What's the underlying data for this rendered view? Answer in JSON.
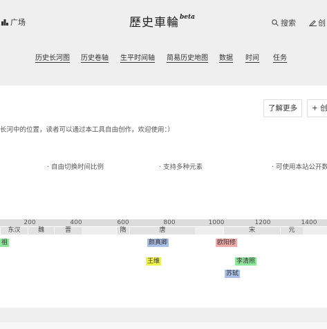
{
  "header": {
    "square_label": "广场",
    "logo_text": "歷史車輪",
    "logo_badge": "beta",
    "search_label": "搜索",
    "create_label": "创"
  },
  "nav": {
    "items": [
      "历史长河图",
      "历史卷轴",
      "生平时间轴",
      "简易历史地图",
      "数据",
      "时间",
      "任务"
    ]
  },
  "card": {
    "learn_more": "了解更多",
    "create_button": "+ 创",
    "intro_text": "长河中的位置，读者可以通过本工具自由创作，欢迎使用：）",
    "features": [
      "· 自由切换时间比例",
      "· 支持多种元素",
      "· 可使用本站公开数"
    ]
  },
  "timeline": {
    "ticks": [
      "200",
      "400",
      "600",
      "800",
      "1000",
      "1200",
      "1400"
    ],
    "dynasties": [
      "东汉",
      "魏",
      "晋",
      "隋",
      "唐",
      "宋",
      "元"
    ],
    "persons": [
      "祖",
      "颜真卿",
      "欧阳修",
      "王维",
      "李清照",
      "苏轼"
    ]
  },
  "colors": {
    "page_bg": "#efefef",
    "card_bg": "#ffffff",
    "axis_bg": "#dcdcdc",
    "person_blue": "#aabfe8",
    "person_red": "#f1a9a9",
    "person_yellow": "#eef24a",
    "person_green": "#8ee69a"
  }
}
